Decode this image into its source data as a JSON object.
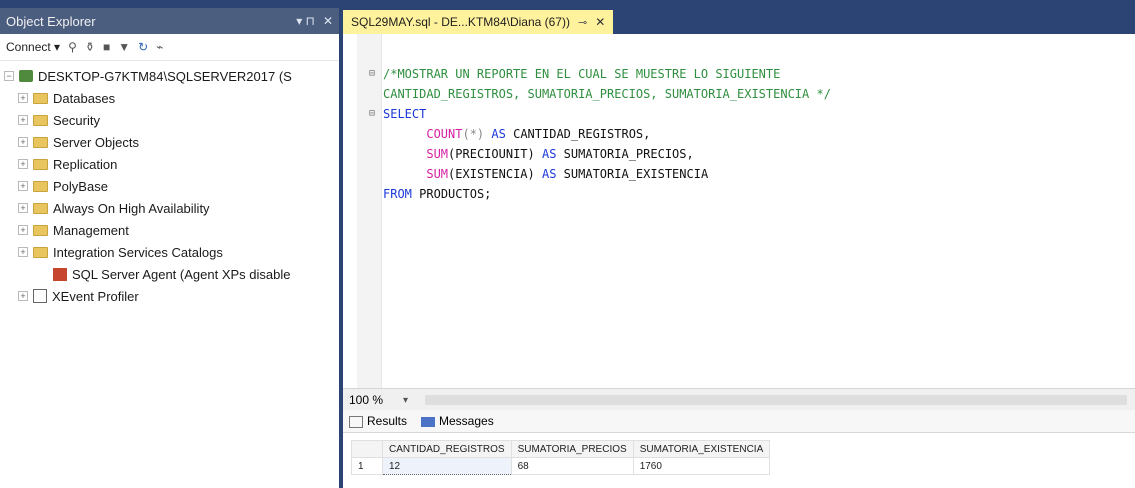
{
  "object_explorer": {
    "title": "Object Explorer",
    "pin_glyph": "▾ ⊓",
    "close_glyph": "✕",
    "toolbar": {
      "connect_label": "Connect",
      "dropdown_glyph": "▾"
    },
    "server_node": "DESKTOP-G7KTM84\\SQLSERVER2017 (S",
    "folders": [
      "Databases",
      "Security",
      "Server Objects",
      "Replication",
      "PolyBase",
      "Always On High Availability",
      "Management",
      "Integration Services Catalogs"
    ],
    "agent_node": "SQL Server Agent (Agent XPs disable",
    "xevent_node": "XEvent Profiler"
  },
  "document_tab": {
    "title": "SQL29MAY.sql - DE...KTM84\\Diana (67))",
    "pin_glyph": "⊸",
    "close_glyph": "✕"
  },
  "editor": {
    "comment_line1": "/*MOSTRAR UN REPORTE EN EL CUAL SE MUESTRE LO SIGUIENTE",
    "comment_line2": "CANTIDAD_REGISTROS, SUMATORIA_PRECIOS, SUMATORIA_EXISTENCIA */",
    "select_kw": "SELECT",
    "count_fn": "COUNT",
    "count_arg": "(*)",
    "as_kw": "AS",
    "alias1": "CANTIDAD_REGISTROS,",
    "sum_fn": "SUM",
    "sum_arg1": "(PRECIOUNIT)",
    "alias2": "SUMATORIA_PRECIOS,",
    "sum_arg2": "(EXISTENCIA)",
    "alias3": "SUMATORIA_EXISTENCIA",
    "from_kw": "FROM",
    "table": "PRODUCTOS;"
  },
  "statusbar": {
    "zoom": "100 %",
    "zoom_dd": "▾"
  },
  "results_tabs": {
    "results": "Results",
    "messages": "Messages"
  },
  "grid": {
    "columns": [
      "CANTIDAD_REGISTROS",
      "SUMATORIA_PRECIOS",
      "SUMATORIA_EXISTENCIA"
    ],
    "rows": [
      {
        "num": "1",
        "values": [
          "12",
          "68",
          "1760"
        ]
      }
    ]
  }
}
